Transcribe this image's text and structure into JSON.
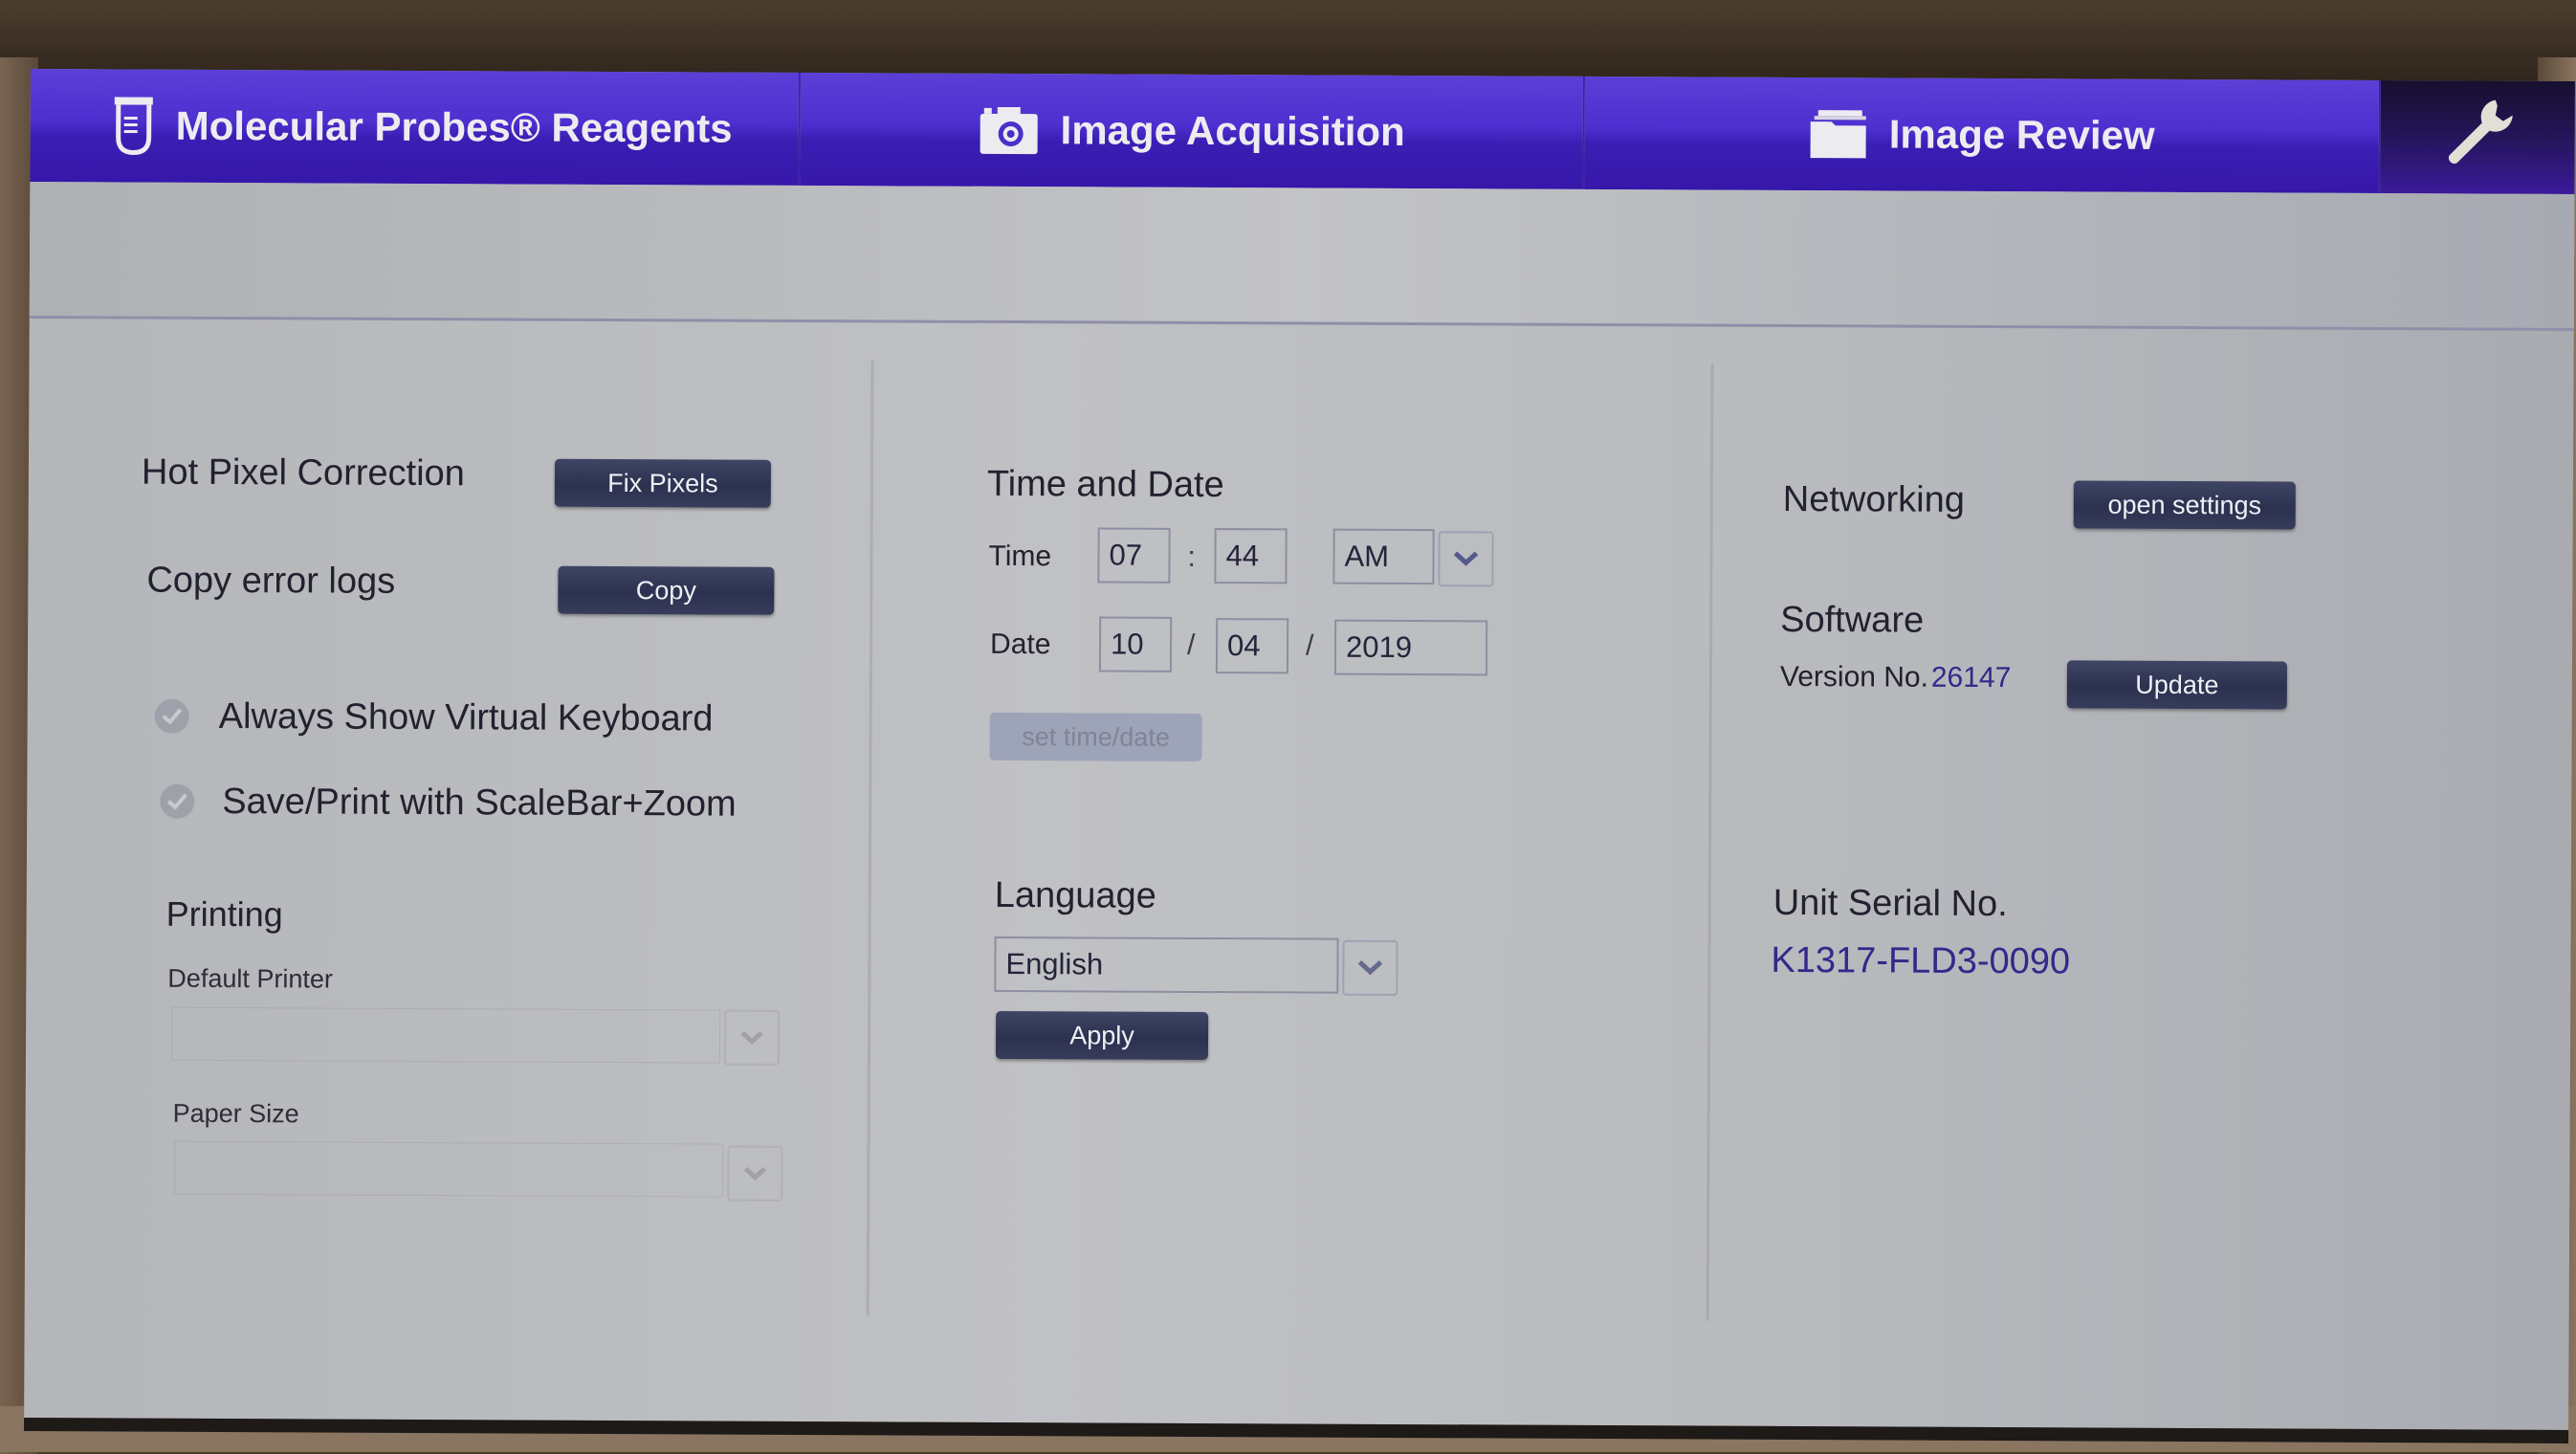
{
  "nav": {
    "tabs": [
      {
        "label": "Molecular Probes® Reagents",
        "icon": "reagent-tube-icon"
      },
      {
        "label": "Image Acquisition",
        "icon": "camera-icon"
      },
      {
        "label": "Image Review",
        "icon": "folder-icon"
      }
    ],
    "tools_icon": "wrench-icon",
    "active": "tools"
  },
  "left": {
    "hot_pixel": {
      "label": "Hot Pixel Correction",
      "button": "Fix Pixels"
    },
    "error_logs": {
      "label": "Copy error logs",
      "button": "Copy"
    },
    "options": [
      {
        "label": "Always Show Virtual Keyboard",
        "checked": true
      },
      {
        "label": "Save/Print with ScaleBar+Zoom",
        "checked": true
      }
    ],
    "printing": {
      "title": "Printing",
      "default_printer_label": "Default Printer",
      "default_printer_value": "",
      "paper_size_label": "Paper Size",
      "paper_size_value": ""
    }
  },
  "middle": {
    "time_date": {
      "title": "Time and Date",
      "time_label": "Time",
      "hour": "07",
      "time_sep": ":",
      "minute": "44",
      "ampm": "AM",
      "date_label": "Date",
      "month": "10",
      "date_sep": "/",
      "day": "04",
      "year": "2019",
      "set_button": "set time/date"
    },
    "language": {
      "title": "Language",
      "selected": "English",
      "apply_button": "Apply"
    }
  },
  "right": {
    "networking": {
      "label": "Networking",
      "button": "open settings"
    },
    "software": {
      "title": "Software",
      "version_label": "Version No.",
      "version": "26147",
      "button": "Update"
    },
    "serial": {
      "label": "Unit Serial No.",
      "value": "K1317-FLD3-0090"
    }
  },
  "colors": {
    "nav_purple": "#4e2fd0",
    "button_navy": "#2c3150",
    "accent_text": "#35278a"
  }
}
